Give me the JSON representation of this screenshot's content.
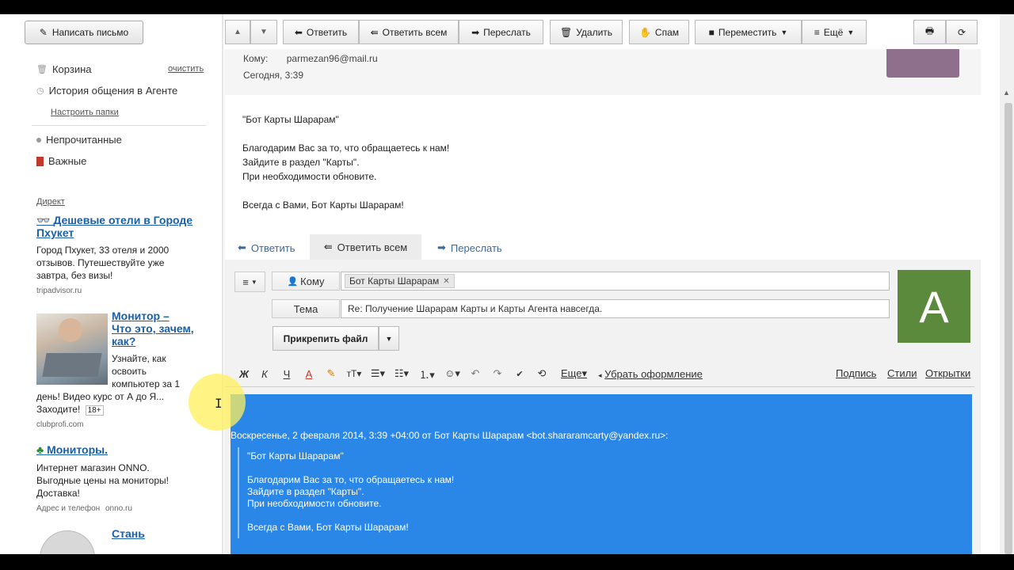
{
  "sidebar": {
    "compose": "Написать письмо",
    "folders": [
      {
        "label": "Корзина",
        "action": "очистить"
      },
      {
        "label": "История общения в Агенте"
      }
    ],
    "setup": "Настроить папки",
    "filters": [
      {
        "label": "Непрочитанные"
      },
      {
        "label": "Важные"
      }
    ]
  },
  "ads": {
    "header": "Директ",
    "items": [
      {
        "title": "Дешевые отели в Городе Пхукет",
        "text": [
          "Город Пхукет, 33 отеля и 2000",
          "отзывов. Путешествуйте уже",
          "завтра, без визы!"
        ],
        "source": "tripadvisor.ru"
      },
      {
        "title": "Монитор – Что это, зачем, как?",
        "title_lines": [
          "Монитор –",
          "Что это, зачем,",
          "как?"
        ],
        "text": [
          "Узнайте, как",
          "освоить",
          "компьютер за 1",
          "день! Видео курс от А до Я...",
          "Заходите!"
        ],
        "age": "18+",
        "source": "clubprofi.com"
      },
      {
        "title": "Мониторы.",
        "text": [
          "Интернет магазин ONNO.",
          "Выгодные цены на мониторы!",
          "Доставка!"
        ],
        "source_label": "Адрес и телефон",
        "source": "onno.ru"
      },
      {
        "title": "Стань"
      }
    ]
  },
  "toolbar": {
    "reply": "Ответить",
    "reply_all": "Ответить всем",
    "forward": "Переслать",
    "delete": "Удалить",
    "spam": "Спам",
    "move": "Переместить",
    "more": "Ещё"
  },
  "message": {
    "to_label": "Кому:",
    "to": "parmezan96@mail.ru",
    "date": "Сегодня, 3:39",
    "body": [
      "\"Бот Карты Шарарам\"",
      "",
      "Благодарим Вас за то, что обращаетесь к нам!",
      "Зайдите в раздел \"Карты\".",
      "При необходимости обновите.",
      "",
      "Всегда с Вами, Бот Карты Шарарам!"
    ]
  },
  "reply_actions": {
    "reply": "Ответить",
    "reply_all": "Ответить всем",
    "forward": "Переслать"
  },
  "compose": {
    "to_label": "Кому",
    "to_chip": "Бот Карты Шарарам",
    "subject_label": "Тема",
    "subject": "Re: Получение Шарарам Карты и Карты Агента навсегда.",
    "attach": "Прикрепить файл",
    "avatar_letter": "А"
  },
  "editor": {
    "bold": "Ж",
    "italic": "К",
    "underline": "Ч",
    "more": "Еще",
    "clear": "Убрать оформление",
    "signature": "Подпись",
    "styles": "Стили",
    "cards": "Открытки"
  },
  "quote": {
    "header": "Воскресенье, 2 февраля 2014, 3:39 +04:00 от Бот Карты Шарарам <bot.shararamcarty@yandex.ru>:",
    "lines": [
      "\"Бот Карты Шарарам\"",
      "",
      "Благодарим Вас за то, что обращаетесь к нам!",
      "Зайдите в раздел \"Карты\".",
      "При необходимости обновите.",
      "",
      "Всегда с Вами, Бот Карты Шарарам!"
    ]
  },
  "colors": {
    "accent_blue": "#2a87e8",
    "avatar_green": "#5b8a3c",
    "link": "#1a5fa9"
  }
}
